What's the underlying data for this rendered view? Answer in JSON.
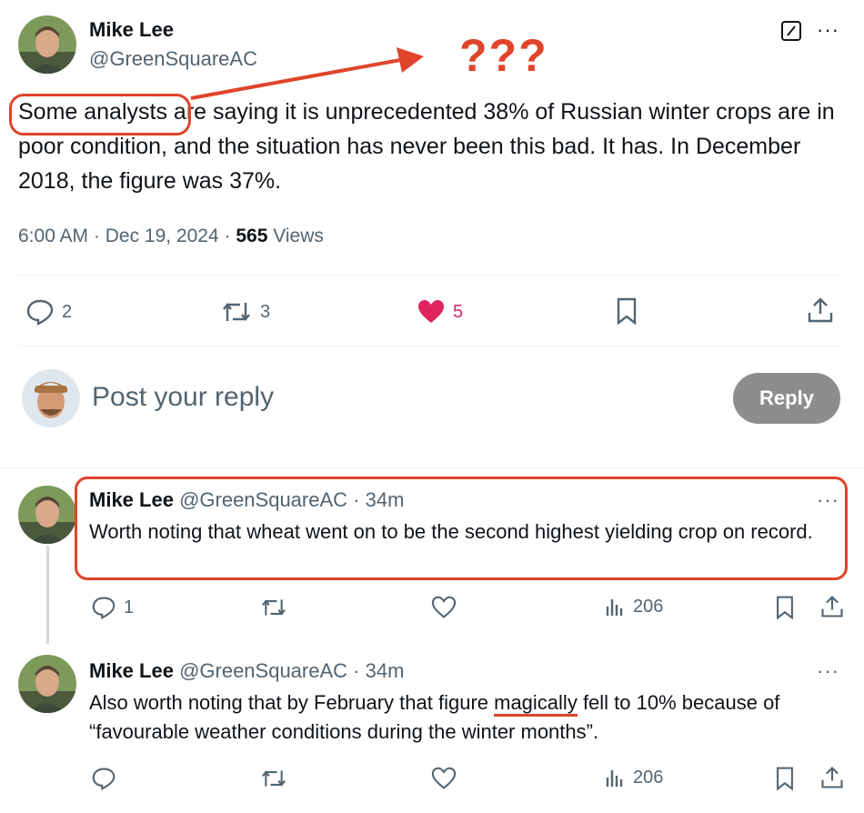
{
  "main_tweet": {
    "author_name": "Mike Lee",
    "handle": "@GreenSquareAC",
    "text_prefix": "Some analysts",
    "text_rest": " are saying it is unprecedented 38% of Russian winter crops are in poor condition, and the situation has never been this bad. It has. In December 2018, the figure was 37%.",
    "time": "6:00 AM",
    "date_sep": " · ",
    "date": "Dec 19, 2024",
    "views_sep": " · ",
    "views_count": "565",
    "views_label": " Views",
    "replies": "2",
    "reposts": "3",
    "likes": "5",
    "more": "···"
  },
  "annotation": {
    "question_marks": "???",
    "color": "#e0442b"
  },
  "compose": {
    "placeholder": "Post your reply",
    "reply_button": "Reply"
  },
  "replies": [
    {
      "author_name": "Mike Lee",
      "handle": "@GreenSquareAC",
      "time_sep": " · ",
      "time": "34m",
      "text": "Worth noting that wheat went on to be the second highest yielding crop on record.",
      "replies": "1",
      "reposts": "",
      "likes": "",
      "views": "206",
      "more": "···"
    },
    {
      "author_name": "Mike Lee",
      "handle": "@GreenSquareAC",
      "time_sep": " · ",
      "time": "34m",
      "text_before": "Also worth noting that by February that figure ",
      "text_underlined": "magically",
      "text_after": " fell to 10% because of “favourable weather conditions during the winter months”.",
      "replies": "",
      "reposts": "",
      "likes": "",
      "views": "206",
      "more": "···"
    }
  ],
  "colors": {
    "text": "#0f1419",
    "muted": "#536471",
    "like": "#e0245e",
    "annotation": "#e0442b",
    "reply_button_bg": "#8b8d8f"
  }
}
